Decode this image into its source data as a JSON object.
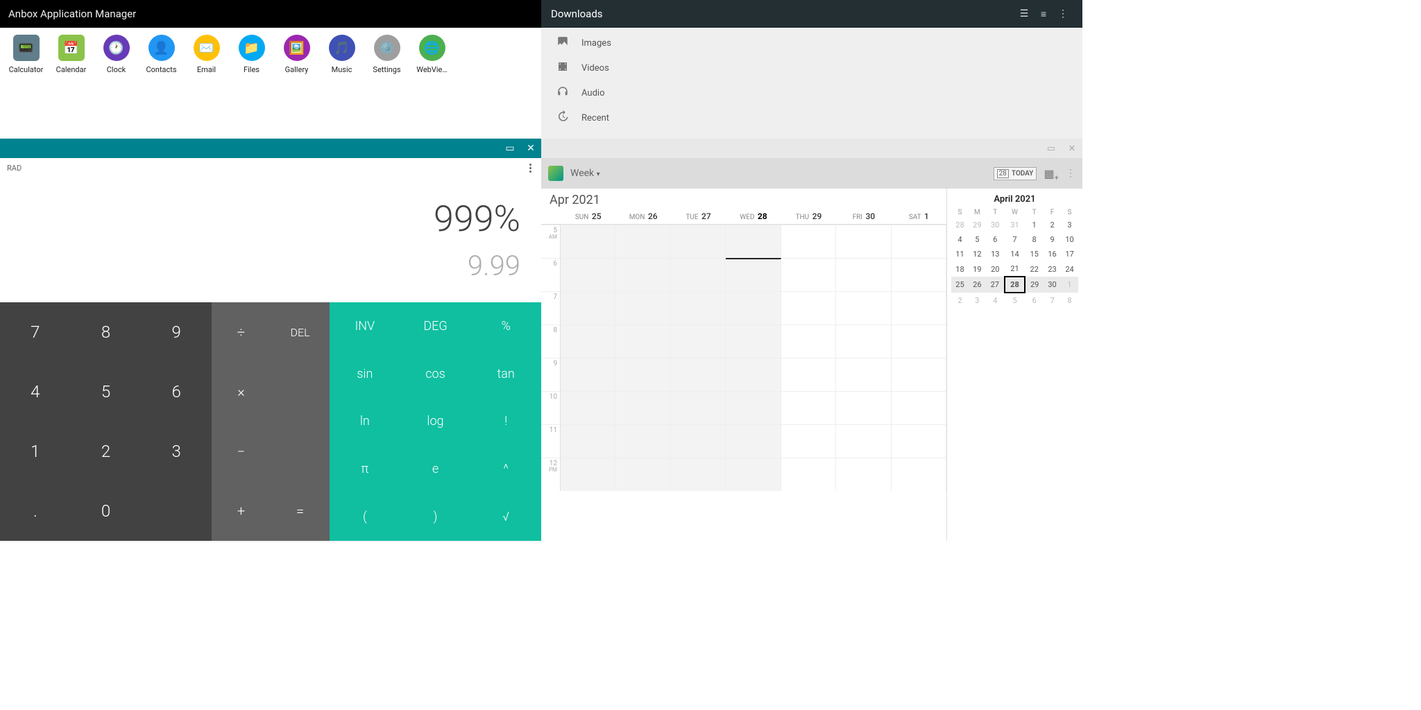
{
  "anbox": {
    "title": "Anbox Application Manager",
    "apps": [
      "Calculator",
      "Calendar",
      "Clock",
      "Contacts",
      "Email",
      "Files",
      "Gallery",
      "Music",
      "Settings",
      "WebVie…"
    ]
  },
  "calc": {
    "mode": "RAD",
    "expression": "999%",
    "result": "9.99",
    "digits": [
      "7",
      "8",
      "9",
      "4",
      "5",
      "6",
      "1",
      "2",
      "3",
      ".",
      "0",
      ""
    ],
    "ops": {
      "div": "÷",
      "del": "DEL",
      "mul": "×",
      "sub": "−",
      "add": "+",
      "eq": "="
    },
    "funcs": [
      "INV",
      "DEG",
      "%",
      "sin",
      "cos",
      "tan",
      "ln",
      "log",
      "!",
      "π",
      "e",
      "^",
      "(",
      ")",
      "√"
    ]
  },
  "downloads": {
    "title": "Downloads",
    "items": [
      "Images",
      "Videos",
      "Audio",
      "Recent"
    ]
  },
  "calendar": {
    "view": "Week",
    "today_label": "TODAY",
    "today_num": "28",
    "month": "Apr 2021",
    "days": [
      {
        "dow": "SUN",
        "num": "25",
        "past": true
      },
      {
        "dow": "MON",
        "num": "26",
        "past": true
      },
      {
        "dow": "TUE",
        "num": "27",
        "past": true
      },
      {
        "dow": "WED",
        "num": "28",
        "past": true,
        "today": true
      },
      {
        "dow": "THU",
        "num": "29"
      },
      {
        "dow": "FRI",
        "num": "30"
      },
      {
        "dow": "SAT",
        "num": "1"
      }
    ],
    "hours": [
      {
        "t": "5",
        "s": "AM"
      },
      {
        "t": "6"
      },
      {
        "t": "7"
      },
      {
        "t": "8"
      },
      {
        "t": "9"
      },
      {
        "t": "10"
      },
      {
        "t": "11"
      },
      {
        "t": "12",
        "s": "PM"
      }
    ],
    "mini": {
      "title": "April 2021",
      "dow": [
        "S",
        "M",
        "T",
        "W",
        "T",
        "F",
        "S"
      ],
      "rows": [
        [
          {
            "n": "28",
            "dim": 1
          },
          {
            "n": "29",
            "dim": 1
          },
          {
            "n": "30",
            "dim": 1
          },
          {
            "n": "31",
            "dim": 1
          },
          {
            "n": "1",
            "b": 1
          },
          {
            "n": "2",
            "b": 1
          },
          {
            "n": "3",
            "b": 1
          }
        ],
        [
          {
            "n": "4"
          },
          {
            "n": "5"
          },
          {
            "n": "6"
          },
          {
            "n": "7"
          },
          {
            "n": "8"
          },
          {
            "n": "9"
          },
          {
            "n": "10"
          }
        ],
        [
          {
            "n": "11"
          },
          {
            "n": "12"
          },
          {
            "n": "13"
          },
          {
            "n": "14"
          },
          {
            "n": "15"
          },
          {
            "n": "16"
          },
          {
            "n": "17"
          }
        ],
        [
          {
            "n": "18"
          },
          {
            "n": "19"
          },
          {
            "n": "20"
          },
          {
            "n": "21"
          },
          {
            "n": "22"
          },
          {
            "n": "23"
          },
          {
            "n": "24"
          }
        ],
        [
          {
            "n": "25",
            "wk": 1
          },
          {
            "n": "26",
            "wk": 1
          },
          {
            "n": "27",
            "wk": 1
          },
          {
            "n": "28",
            "wk": 1,
            "today": 1
          },
          {
            "n": "29",
            "wk": 1
          },
          {
            "n": "30",
            "wk": 1
          },
          {
            "n": "1",
            "wk": 1,
            "dim": 1
          }
        ],
        [
          {
            "n": "2",
            "dim": 1
          },
          {
            "n": "3",
            "dim": 1
          },
          {
            "n": "4",
            "dim": 1
          },
          {
            "n": "5",
            "dim": 1
          },
          {
            "n": "6",
            "dim": 1
          },
          {
            "n": "7",
            "dim": 1
          },
          {
            "n": "8",
            "dim": 1
          }
        ]
      ]
    }
  }
}
